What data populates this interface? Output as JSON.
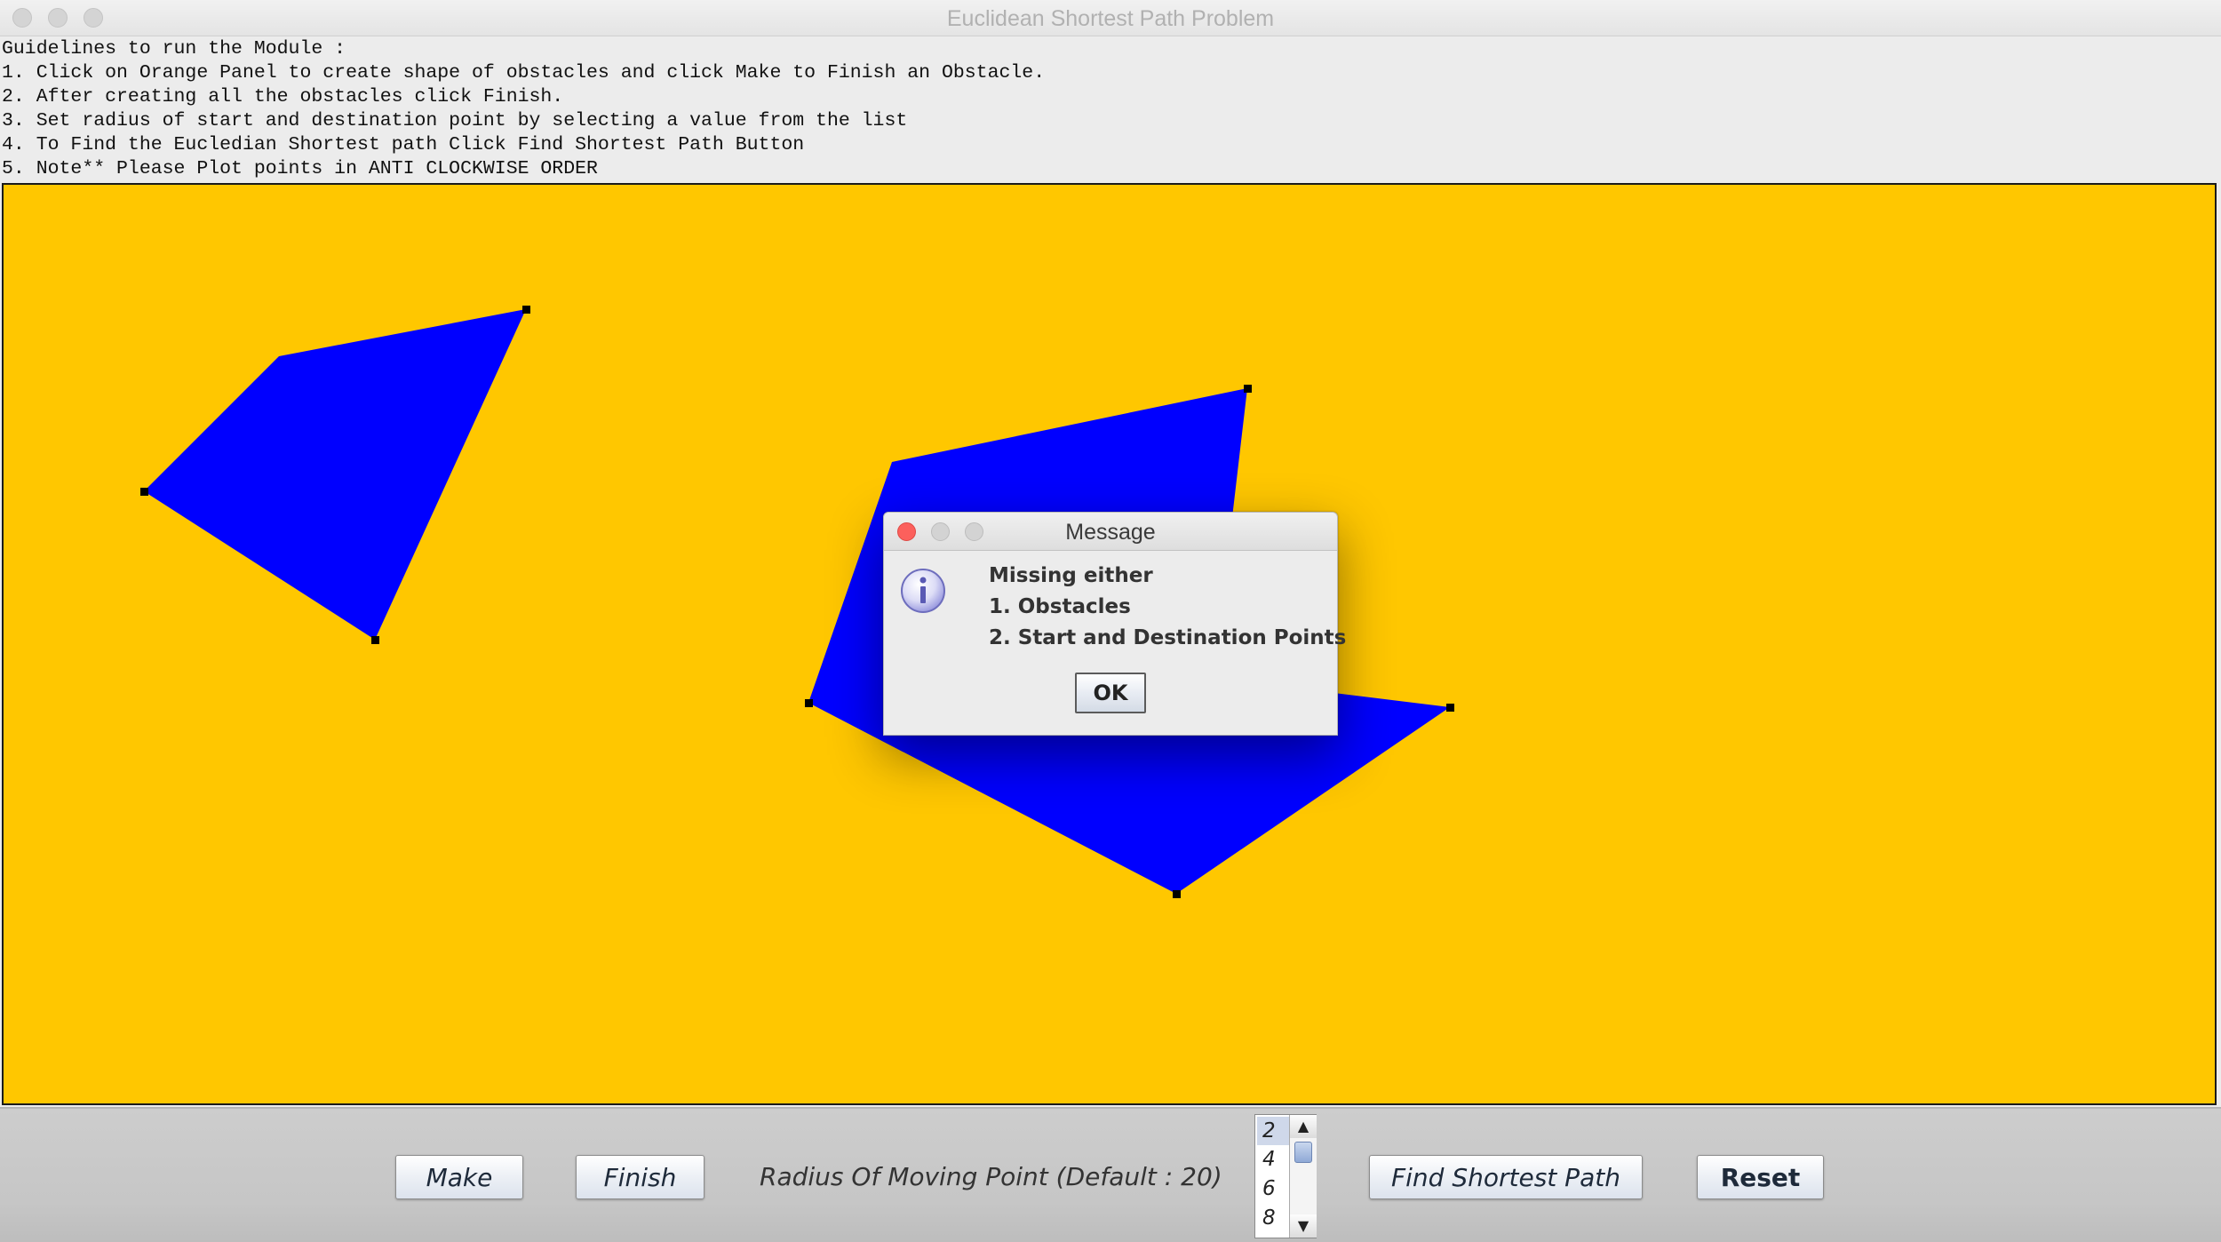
{
  "window": {
    "title": "Euclidean Shortest Path Problem"
  },
  "guidelines": {
    "lines": [
      "Guidelines to run the Module :",
      "1. Click on Orange Panel to create shape of obstacles and click Make to Finish an Obstacle.",
      "2. After creating all the obstacles click Finish.",
      "3. Set radius of start and destination point by selecting a value from the list",
      "4. To Find the Eucledian Shortest path Click Find Shortest Path Button",
      "5. Note** Please Plot points in ANTI CLOCKWISE ORDER"
    ]
  },
  "canvas": {
    "background_color": "#ffc700",
    "obstacle_color": "#0000ff",
    "vertex_color": "#000000"
  },
  "controls": {
    "make_label": "Make",
    "finish_label": "Finish",
    "radius_label": "Radius Of Moving Point (Default : 20)",
    "radius_options": [
      "2",
      "4",
      "6",
      "8"
    ],
    "radius_selected": "2",
    "find_path_label": "Find Shortest Path",
    "reset_label": "Reset"
  },
  "dialog": {
    "title": "Message",
    "icon": "info-icon",
    "lines": [
      "Missing either",
      "1. Obstacles",
      "2. Start and Destination Points"
    ],
    "ok_label": "OK"
  }
}
